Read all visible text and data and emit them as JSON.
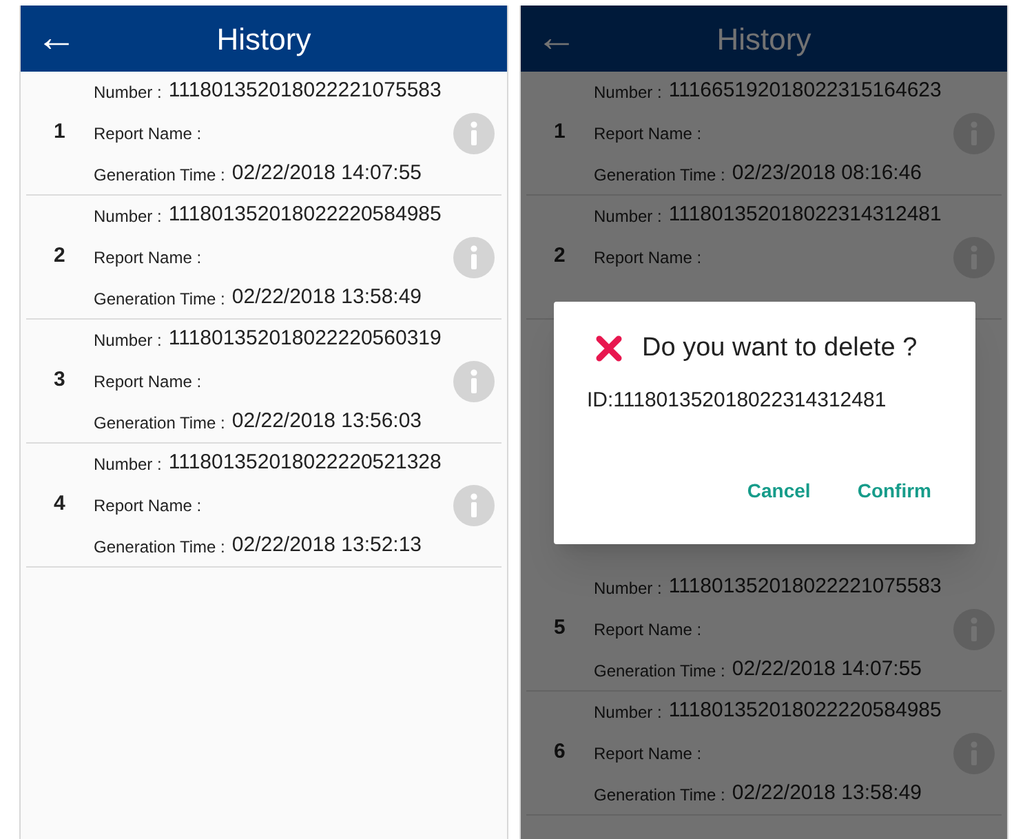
{
  "screens": [
    {
      "back_icon": "←",
      "title": "History",
      "items": [
        {
          "index": "1",
          "number_label": "Number :",
          "number": "111801352018022221075583",
          "report_name_label": "Report Name :",
          "time_label": "Generation Time :",
          "time": "02/22/2018 14:07:55"
        },
        {
          "index": "2",
          "number_label": "Number :",
          "number": "111801352018022220584985",
          "report_name_label": "Report Name :",
          "time_label": "Generation Time :",
          "time": "02/22/2018 13:58:49"
        },
        {
          "index": "3",
          "number_label": "Number :",
          "number": "111801352018022220560319",
          "report_name_label": "Report Name :",
          "time_label": "Generation Time :",
          "time": "02/22/2018 13:56:03"
        },
        {
          "index": "4",
          "number_label": "Number :",
          "number": "111801352018022220521328",
          "report_name_label": "Report Name :",
          "time_label": "Generation Time :",
          "time": "02/22/2018 13:52:13"
        }
      ]
    },
    {
      "back_icon": "←",
      "title": "History",
      "items": [
        {
          "index": "1",
          "number_label": "Number :",
          "number": "111665192018022315164623",
          "report_name_label": "Report Name :",
          "time_label": "Generation Time :",
          "time": "02/23/2018 08:16:46"
        },
        {
          "index": "2",
          "number_label": "Number :",
          "number": "111801352018022314312481",
          "report_name_label": "Report Name :"
        },
        {
          "index": "5",
          "number_label": "Number :",
          "number": "111801352018022221075583",
          "report_name_label": "Report Name :",
          "time_label": "Generation Time :",
          "time": "02/22/2018 14:07:55"
        },
        {
          "index": "6",
          "number_label": "Number :",
          "number": "111801352018022220584985",
          "report_name_label": "Report Name :",
          "time_label": "Generation Time :",
          "time": "02/22/2018 13:58:49"
        }
      ],
      "dialog": {
        "title": "Do you want to delete ?",
        "message": "ID:111801352018022314312481",
        "buttons": [
          "Cancel",
          "Confirm"
        ]
      }
    }
  ]
}
